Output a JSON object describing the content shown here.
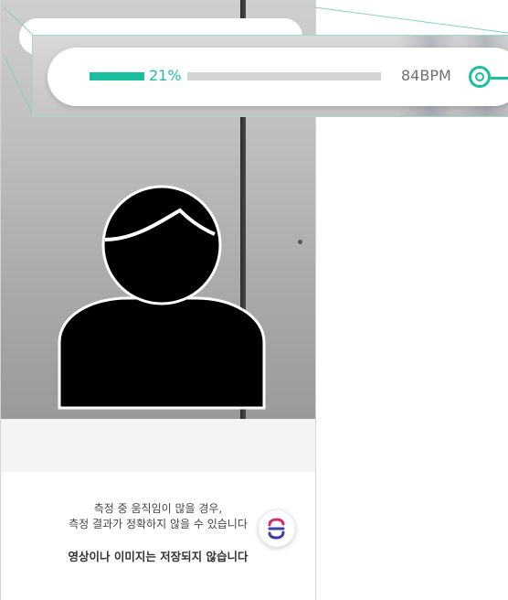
{
  "measurement": {
    "progress_percent_label": "21%",
    "progress_fraction": 0.21,
    "bpm_label": "84BPM"
  },
  "notice": {
    "line1": "측정 중 움직임이 많을 경우,",
    "line2": "측정 결과가 정확하지 않을 수 있습니다",
    "privacy": "영상이나 이미지는 저장되지 않습니다"
  },
  "icons": {
    "face_guide": "person-silhouette-icon",
    "heart_indicator": "heart-rate-indicator-icon",
    "brand": "sd-logo-icon"
  },
  "colors": {
    "accent": "#1bbf9f",
    "track": "#d4d4d4",
    "text_muted": "#6f6f6f"
  }
}
